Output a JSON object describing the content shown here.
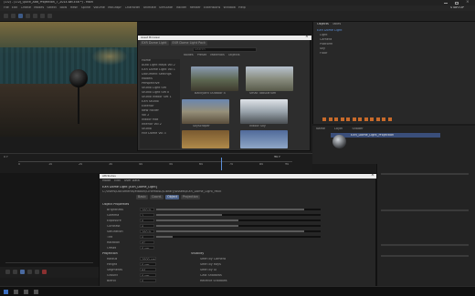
{
  "window": {
    "title": "(1.0) - (1.0)_Quick_Add_Projection_7_2014.sat.c4d *) - Main"
  },
  "menu": {
    "items": [
      "File",
      "Edit",
      "Create",
      "Modes",
      "Select",
      "Tools",
      "Mesh",
      "Spline",
      "Volume",
      "MoGraph",
      "Character",
      "Animate",
      "Simulate",
      "Tracker",
      "Render",
      "Extensions",
      "Window",
      "Help"
    ]
  },
  "top_right": {
    "label": "STARTUP"
  },
  "browser": {
    "title": "Asset Browser",
    "tabs": [
      "EXR Dome Light",
      "EXR Dome Light Pack"
    ],
    "search_placeholder": "Search",
    "toolbar": [
      "Nodes",
      "Preset",
      "Materials",
      "Objects"
    ],
    "sidebar": [
      "Home",
      "Auto Light Maps Vol 2",
      "EXR Dome Light Vol 1",
      "Document Settings",
      "Models",
      "Perspective",
      "Studio Light Set",
      "Studio Light Set II",
      "Studio Indoor Set 1",
      "EXR Studio",
      "Exterior",
      "New Folder",
      "Vol 2",
      "Indoor Mat",
      "Interior Vol 2",
      "Studio",
      "Hdr Dome Vol 3"
    ],
    "thumbs": [
      {
        "label": "Backyard Outdoor 4"
      },
      {
        "label": "Small Tabularium"
      },
      {
        "label": "Skyscraper"
      },
      {
        "label": "Indoor Sky"
      },
      {
        "label": ""
      },
      {
        "label": ""
      }
    ]
  },
  "right_panel": {
    "tabs": [
      "Objects",
      "Takes"
    ],
    "objects": [
      "EXR Dome Light",
      "Light",
      "Camera",
      "Platform",
      "Sky",
      "Floor"
    ]
  },
  "materials": {
    "header": [
      "Name",
      "Layer",
      "Shader"
    ],
    "row": "EXR_Dome_Light_Projection"
  },
  "timeline": {
    "frame_label": "0 F",
    "frames": [
      "0",
      "10",
      "20",
      "30",
      "40",
      "50",
      "60",
      "70",
      "80",
      "90"
    ],
    "end_label": "90 F"
  },
  "attributes": {
    "title": "Attributes",
    "menu": [
      "Mode",
      "Edit",
      "User Data"
    ],
    "object_label": "EXR Dome Light [EXR_Dome_Light]",
    "path": "C:/Users/Documents/Maxon/Cinema4D/Library/Assets/EXR_Dome_Light_Pack",
    "tabs": [
      "Basic",
      "Coord.",
      "Object",
      "Projection"
    ],
    "section1": "Object Properties",
    "rows": [
      {
        "label": "Brightness",
        "value": "100 %"
      },
      {
        "label": "Gamma",
        "value": "1"
      },
      {
        "label": "Exposure",
        "value": "0"
      },
      {
        "label": "Contrast",
        "value": "0"
      },
      {
        "label": "Saturation",
        "value": "100 %"
      },
      {
        "label": "Tint",
        "value": "0"
      },
      {
        "label": "Rotation",
        "value": "0°"
      },
      {
        "label": "Offset",
        "value": "0 cm"
      }
    ],
    "section2": "Projection",
    "rows2": [
      {
        "label": "Radius",
        "value": "1000 cm"
      },
      {
        "label": "Height",
        "value": "0 cm"
      },
      {
        "label": "Segments",
        "value": "64"
      },
      {
        "label": "Ground",
        "value": "0 cm"
      },
      {
        "label": "Blend",
        "value": "0"
      }
    ],
    "section3": "Visibility",
    "rows3": [
      {
        "label": "Seen by Camera",
        "value": ""
      },
      {
        "label": "Seen by Rays",
        "value": ""
      },
      {
        "label": "Seen by GI",
        "value": ""
      },
      {
        "label": "Cast Shadows",
        "value": ""
      },
      {
        "label": "Receive Shadows",
        "value": ""
      }
    ],
    "section4": "Dome Settings"
  }
}
